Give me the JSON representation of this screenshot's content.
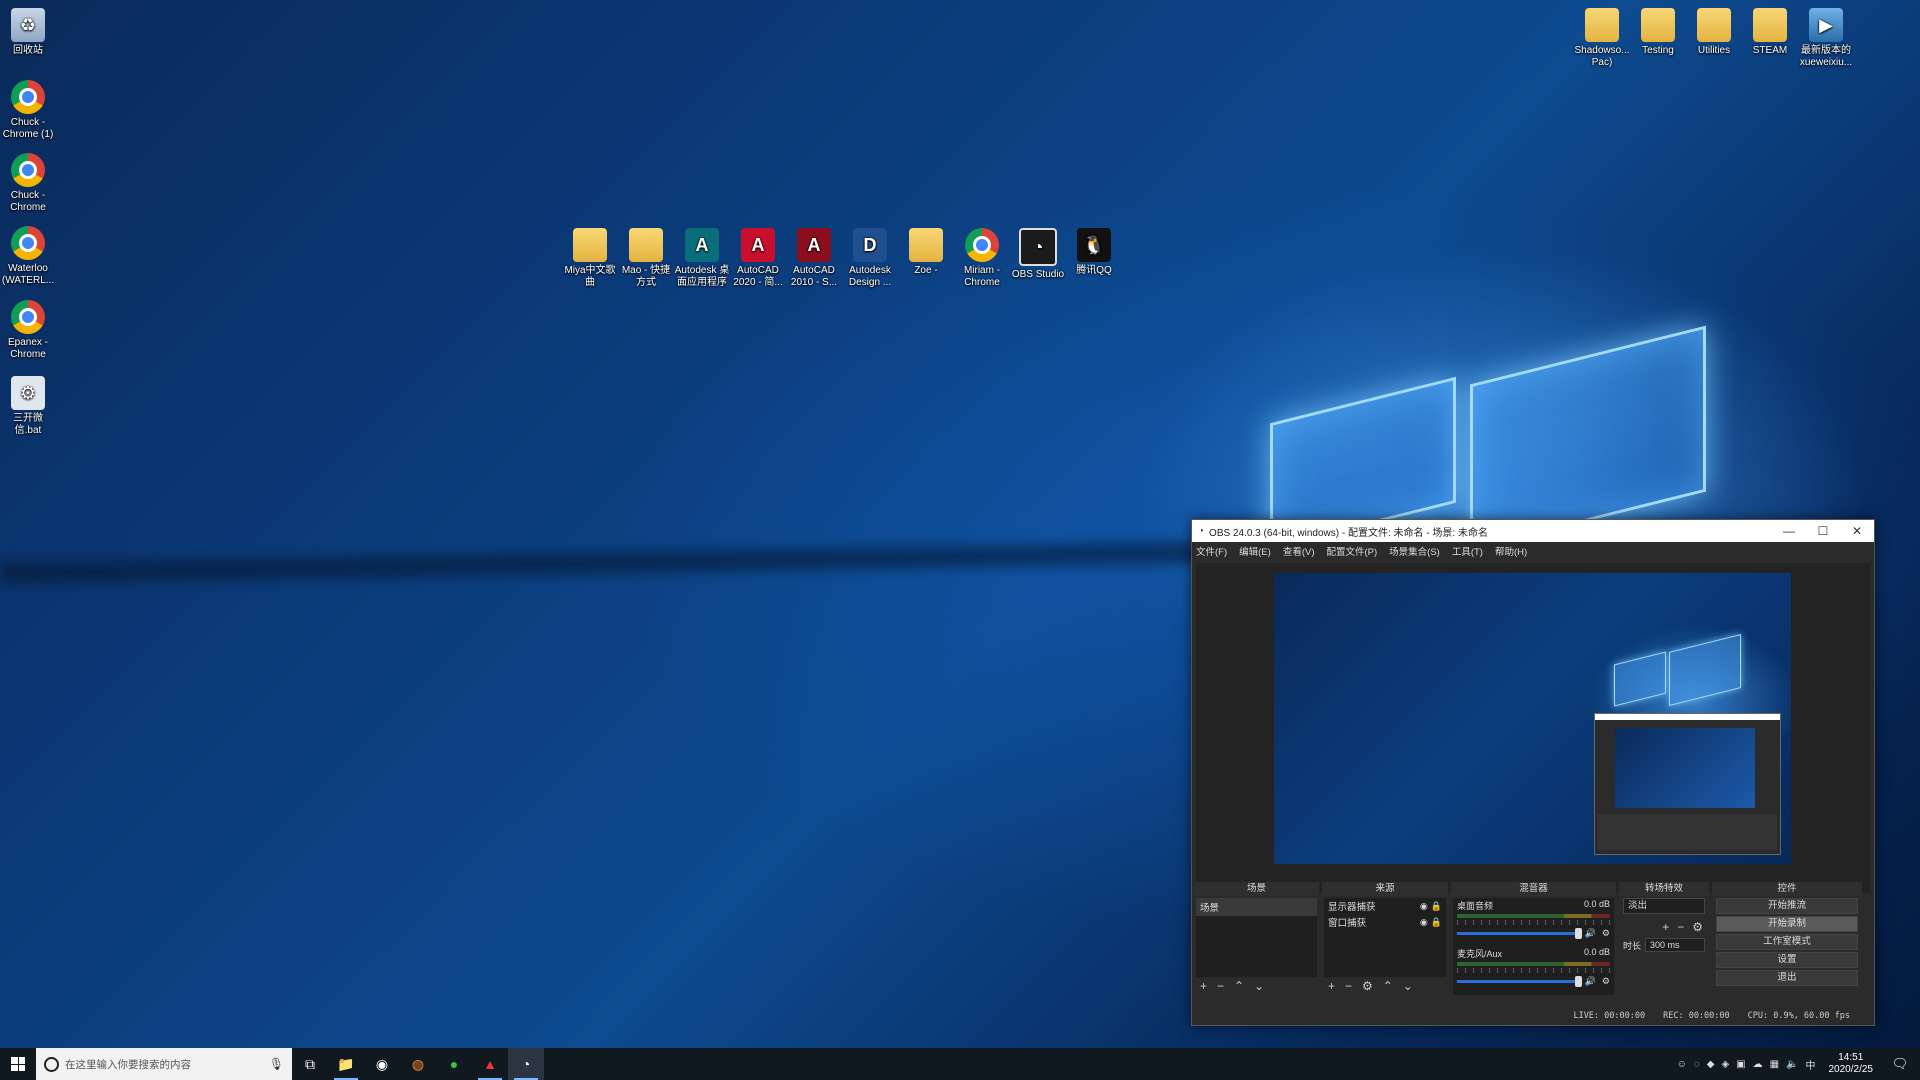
{
  "desktop": {
    "left_icons": [
      {
        "label": "回收站",
        "icon": "recycle-bin-icon"
      },
      {
        "label": "Chuck - Chrome (1)",
        "icon": "chrome-icon"
      },
      {
        "label": "Chuck - Chrome",
        "icon": "chrome-icon"
      },
      {
        "label": "Waterloo (WATERL...",
        "icon": "chrome-icon"
      },
      {
        "label": "Epanex - Chrome",
        "icon": "chrome-icon"
      },
      {
        "label": "三开微信.bat",
        "icon": "batch-file-icon"
      }
    ],
    "right_icons": [
      {
        "label": "Shadowso... Pac)",
        "icon": "folder-icon"
      },
      {
        "label": "Testing",
        "icon": "folder-icon"
      },
      {
        "label": "Utilities",
        "icon": "folder-icon"
      },
      {
        "label": "STEAM",
        "icon": "folder-icon"
      },
      {
        "label": "最新版本的 xueweixiu...",
        "icon": "video-file-icon"
      }
    ],
    "center_icons": [
      {
        "label": "Miya中文歌曲",
        "icon": "folder-icon"
      },
      {
        "label": "Mao - 快捷方式",
        "icon": "folder-icon"
      },
      {
        "label": "Autodesk 桌面应用程序",
        "icon": "autodesk-icon"
      },
      {
        "label": "AutoCAD 2020 - 简...",
        "icon": "autocad-icon"
      },
      {
        "label": "AutoCAD 2010 - S...",
        "icon": "autocad-icon"
      },
      {
        "label": "Autodesk Design ...",
        "icon": "revit-icon"
      },
      {
        "label": "Zoe -",
        "icon": "folder-icon"
      },
      {
        "label": "Miriam - Chrome",
        "icon": "chrome-icon"
      },
      {
        "label": "OBS Studio",
        "icon": "obs-icon"
      },
      {
        "label": "腾讯QQ",
        "icon": "qq-icon"
      }
    ]
  },
  "obs": {
    "title": "OBS 24.0.3 (64-bit, windows) - 配置文件: 未命名 - 场景: 未命名",
    "menu": [
      "文件(F)",
      "编辑(E)",
      "查看(V)",
      "配置文件(P)",
      "场景集合(S)",
      "工具(T)",
      "帮助(H)"
    ],
    "docks": {
      "scenes_title": "场景",
      "sources_title": "来源",
      "mixer_title": "混音器",
      "transitions_title": "转场特效",
      "controls_title": "控件"
    },
    "scenes": [
      "场景"
    ],
    "sources": [
      "显示器捕获",
      "窗口捕获"
    ],
    "mixer": [
      {
        "name": "桌面音频",
        "db": "0.0 dB"
      },
      {
        "name": "麦克风/Aux",
        "db": "0.0 dB"
      }
    ],
    "transition": {
      "selected": "淡出",
      "duration_label": "时长",
      "duration_value": "300 ms"
    },
    "controls": [
      "开始推流",
      "开始录制",
      "工作室模式",
      "设置",
      "退出"
    ],
    "status": {
      "live": "LIVE: 00:00:00",
      "rec": "REC: 00:00:00",
      "cpu": "CPU: 0.9%, 60.00 fps"
    }
  },
  "taskbar": {
    "search_placeholder": "在这里输入你要搜索的内容",
    "time": "14:51",
    "date": "2020/2/25",
    "ime": "中"
  },
  "colors": {
    "taskbar": "#101820",
    "obs_bg": "#2b2b2b",
    "accent": "#2a6fd6"
  }
}
